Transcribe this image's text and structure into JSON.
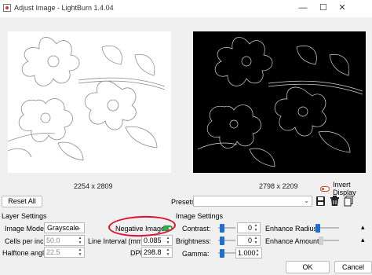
{
  "window": {
    "title": "Adjust Image - LightBurn 1.4.04",
    "minimize_glyph": "—",
    "maximize_glyph": "☐",
    "close_glyph": "✕"
  },
  "preview": {
    "left_dimensions": "2254 x 2809",
    "right_dimensions": "2798 x 2209",
    "invert_display_label": "Invert Display"
  },
  "toolbar": {
    "reset_all_label": "Reset All",
    "presets_label": "Presets",
    "presets_value": "",
    "icons": [
      "save-icon",
      "delete-icon",
      "copy-icon"
    ]
  },
  "layer_settings": {
    "title": "Layer Settings",
    "image_mode_label": "Image Mode:",
    "image_mode_value": "Grayscale",
    "cells_per_inch_label": "Cells per inch",
    "cells_per_inch_value": "50.0",
    "halftone_angle_label": "Halftone angle",
    "halftone_angle_value": "22.5",
    "negative_image_label": "Negative Image",
    "negative_image_on": true,
    "line_interval_label": "Line Interval (mm)",
    "line_interval_value": "0.085",
    "dpi_label": "DPI",
    "dpi_value": "298.8"
  },
  "image_settings": {
    "title": "Image Settings",
    "contrast_label": "Contrast:",
    "contrast_value": "0",
    "brightness_label": "Brightness:",
    "brightness_value": "0",
    "gamma_label": "Gamma:",
    "gamma_value": "1.000",
    "enhance_radius_label": "Enhance Radius:",
    "enhance_amount_label": "Enhance Amount:"
  },
  "buttons": {
    "ok_label": "OK",
    "cancel_label": "Cancel"
  },
  "colors": {
    "annotation_circle": "#e0102b",
    "slider_accent": "#1e6fd0",
    "toggle_on": "#2fb24a"
  }
}
